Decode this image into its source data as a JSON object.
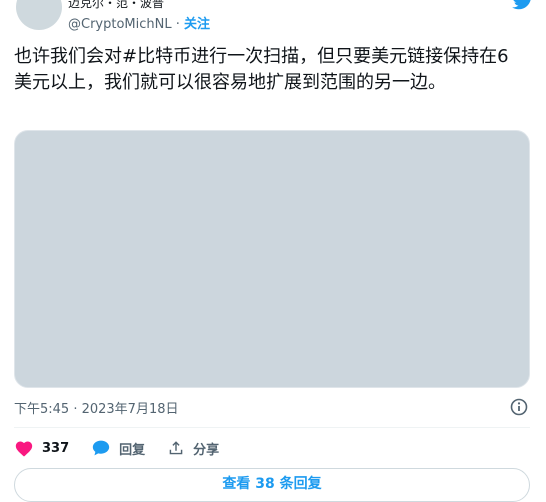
{
  "author": {
    "name": "迈克尔・范・波普",
    "handle": "@CryptoMichNL",
    "follow_label": "关注"
  },
  "tweet": {
    "text": "也许我们会对#比特币进行一次扫描，但只要美元链接保持在6美元以上，我们就可以很容易地扩展到范围的另一边。",
    "timestamp": "下午5:45 · 2023年7月18日"
  },
  "actions": {
    "likes": "337",
    "reply_label": "回复",
    "share_label": "分享"
  },
  "more_replies_label": "查看 38 条回复",
  "colors": {
    "accent": "#1d9bf0",
    "like": "#f91880",
    "muted": "#536471",
    "media_placeholder": "#ccd6dd"
  },
  "icons": [
    "twitter-bird-icon",
    "heart-icon",
    "reply-bubble-icon",
    "share-icon",
    "info-icon"
  ]
}
